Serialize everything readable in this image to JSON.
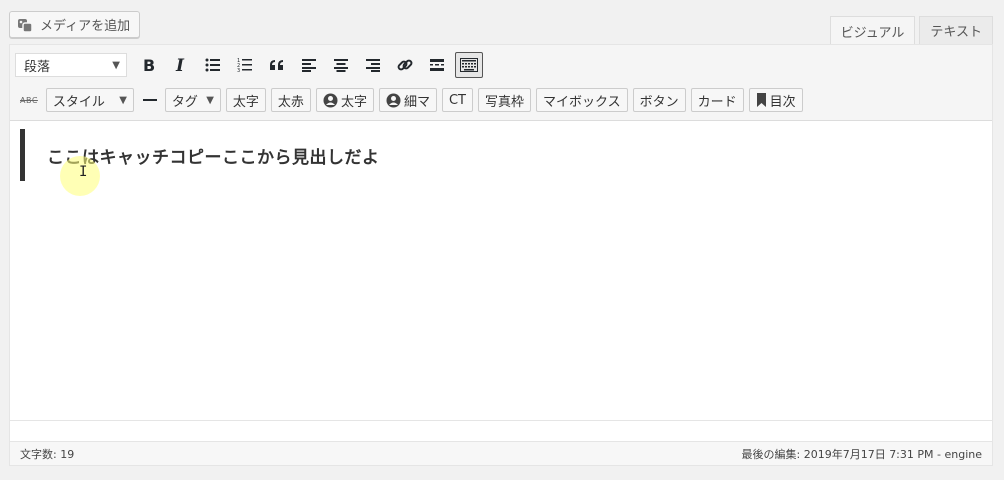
{
  "media_button": {
    "label": "メディアを追加",
    "icon": "media-icon"
  },
  "mode_tabs": [
    {
      "label": "ビジュアル",
      "active": true
    },
    {
      "label": "テキスト",
      "active": false
    }
  ],
  "toolbar": {
    "format_select": {
      "value": "段落"
    },
    "row1_icons": [
      "bold-icon",
      "italic-icon",
      "bullet-list-icon",
      "numbered-list-icon",
      "blockquote-icon",
      "align-left-icon",
      "align-center-icon",
      "align-right-icon",
      "link-icon",
      "read-more-icon",
      "toolbar-toggle-icon"
    ],
    "strikethrough_label": "ABC",
    "style_dropdown": "スタイル",
    "tag_dropdown": "タグ",
    "buttons": [
      {
        "label": "太字",
        "icon": null
      },
      {
        "label": "太赤",
        "icon": null
      },
      {
        "label": "太字",
        "icon": "person-icon"
      },
      {
        "label": "細マ",
        "icon": "person-icon"
      },
      {
        "label": "CT",
        "icon": null
      },
      {
        "label": "写真枠",
        "icon": null
      },
      {
        "label": "マイボックス",
        "icon": null
      },
      {
        "label": "ボタン",
        "icon": null
      },
      {
        "label": "カード",
        "icon": null
      },
      {
        "label": "目次",
        "icon": "bookmark-icon"
      }
    ]
  },
  "content": {
    "heading": "ここはキャッチコピーここから見出しだよ"
  },
  "status": {
    "word_count": "文字数: 19",
    "last_edited": "最後の編集: 2019年7月17日 7:31 PM - engine"
  }
}
